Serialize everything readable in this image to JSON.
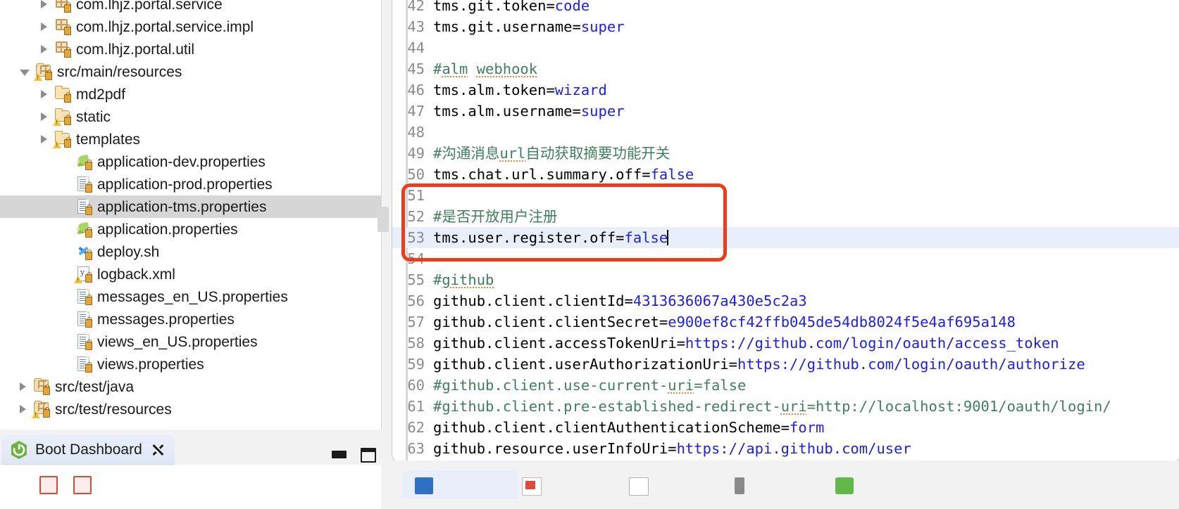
{
  "explorer": {
    "name": "project-explorer",
    "items": [
      {
        "label": "com.lhjz.portal.service",
        "indent": 1,
        "arrow": "right",
        "icon": "package-icon",
        "selected": false
      },
      {
        "label": "com.lhjz.portal.service.impl",
        "indent": 1,
        "arrow": "right",
        "icon": "package-icon",
        "selected": false
      },
      {
        "label": "com.lhjz.portal.util",
        "indent": 1,
        "arrow": "right",
        "icon": "package-icon",
        "selected": false
      },
      {
        "label": "src/main/resources",
        "indent": 0,
        "arrow": "down",
        "icon": "source-folder-warning-icon",
        "selected": false
      },
      {
        "label": "md2pdf",
        "indent": 1,
        "arrow": "right",
        "icon": "folder-icon",
        "selected": false
      },
      {
        "label": "static",
        "indent": 1,
        "arrow": "right",
        "icon": "folder-warning-icon",
        "selected": false
      },
      {
        "label": "templates",
        "indent": 1,
        "arrow": "right",
        "icon": "folder-warning-icon",
        "selected": false
      },
      {
        "label": "application-dev.properties",
        "indent": 2,
        "arrow": "none",
        "icon": "leaf-properties-icon",
        "selected": false
      },
      {
        "label": "application-prod.properties",
        "indent": 2,
        "arrow": "none",
        "icon": "properties-file-icon",
        "selected": false
      },
      {
        "label": "application-tms.properties",
        "indent": 2,
        "arrow": "none",
        "icon": "properties-file-icon",
        "selected": true
      },
      {
        "label": "application.properties",
        "indent": 2,
        "arrow": "none",
        "icon": "leaf-properties-icon",
        "selected": false
      },
      {
        "label": "deploy.sh",
        "indent": 2,
        "arrow": "none",
        "icon": "shell-script-icon",
        "selected": false
      },
      {
        "label": "logback.xml",
        "indent": 2,
        "arrow": "none",
        "icon": "xml-file-warning-icon",
        "selected": false
      },
      {
        "label": "messages_en_US.properties",
        "indent": 2,
        "arrow": "none",
        "icon": "properties-file-icon",
        "selected": false
      },
      {
        "label": "messages.properties",
        "indent": 2,
        "arrow": "none",
        "icon": "properties-file-icon",
        "selected": false
      },
      {
        "label": "views_en_US.properties",
        "indent": 2,
        "arrow": "none",
        "icon": "properties-file-icon",
        "selected": false
      },
      {
        "label": "views.properties",
        "indent": 2,
        "arrow": "none",
        "icon": "properties-file-icon",
        "selected": false
      },
      {
        "label": "src/test/java",
        "indent": 0,
        "arrow": "right",
        "icon": "source-folder-icon",
        "selected": false
      },
      {
        "label": "src/test/resources",
        "indent": 0,
        "arrow": "right",
        "icon": "source-folder-warning-icon",
        "selected": false
      }
    ]
  },
  "bottom_view": {
    "tab_label": "Boot Dashboard",
    "logo_icon": "spring-boot-icon",
    "pin_icon": "pin-view-icon",
    "minimize_icon": "minimize-icon",
    "maximize_icon": "maximize-icon"
  },
  "editor": {
    "name": "application-tms.properties",
    "current_line": 53,
    "cursor_after": "tms.user.register.off=false",
    "annotation": {
      "color": "#ec3c1c",
      "from_line": 51,
      "to_line": 53
    },
    "colors": {
      "text": "#000000",
      "value": "#2020e0",
      "comment": "#3f7f5f",
      "line_number": "#8b8b8b",
      "current_line_bg": "#e9effa",
      "spellcheck_underline": "#e8833a"
    },
    "lines": [
      {
        "n": 42,
        "parts": [
          {
            "t": "tms.git.token=",
            "c": "t"
          },
          {
            "t": "code",
            "c": "v"
          }
        ]
      },
      {
        "n": 43,
        "parts": [
          {
            "t": "tms.git.username=",
            "c": "t"
          },
          {
            "t": "super",
            "c": "v"
          }
        ]
      },
      {
        "n": 44,
        "parts": []
      },
      {
        "n": 45,
        "parts": [
          {
            "t": "#",
            "c": "cm"
          },
          {
            "t": "alm",
            "c": "cm sq"
          },
          {
            "t": " ",
            "c": "cm"
          },
          {
            "t": "webhook",
            "c": "cm sq"
          }
        ]
      },
      {
        "n": 46,
        "parts": [
          {
            "t": "tms.alm.token=",
            "c": "t"
          },
          {
            "t": "wizard",
            "c": "v"
          }
        ]
      },
      {
        "n": 47,
        "parts": [
          {
            "t": "tms.alm.username=",
            "c": "t"
          },
          {
            "t": "super",
            "c": "v"
          }
        ]
      },
      {
        "n": 48,
        "parts": []
      },
      {
        "n": 49,
        "parts": [
          {
            "t": "#沟通消息",
            "c": "cm"
          },
          {
            "t": "url",
            "c": "cm sq"
          },
          {
            "t": "自动获取摘要功能开关",
            "c": "cm"
          }
        ]
      },
      {
        "n": 50,
        "parts": [
          {
            "t": "tms.chat.url.summary.off=",
            "c": "t"
          },
          {
            "t": "false",
            "c": "v"
          }
        ]
      },
      {
        "n": 51,
        "parts": []
      },
      {
        "n": 52,
        "parts": [
          {
            "t": "#是否开放用户注册",
            "c": "cm"
          }
        ]
      },
      {
        "n": 53,
        "parts": [
          {
            "t": "tms.user.register.off=",
            "c": "t"
          },
          {
            "t": "false",
            "c": "v"
          }
        ],
        "current": true,
        "caret": true
      },
      {
        "n": 54,
        "parts": []
      },
      {
        "n": 55,
        "parts": [
          {
            "t": "#",
            "c": "cm"
          },
          {
            "t": "github",
            "c": "cm sq"
          }
        ]
      },
      {
        "n": 56,
        "parts": [
          {
            "t": "github.client.clientId=",
            "c": "t"
          },
          {
            "t": "4313636067a430e5c2a3",
            "c": "v"
          }
        ]
      },
      {
        "n": 57,
        "parts": [
          {
            "t": "github.client.clientSecret=",
            "c": "t"
          },
          {
            "t": "e900ef8cf42ffb045de54db8024f5e4af695a148",
            "c": "v"
          }
        ]
      },
      {
        "n": 58,
        "parts": [
          {
            "t": "github.client.accessTokenUri=",
            "c": "t"
          },
          {
            "t": "https://github.com/login/oauth/access_token",
            "c": "v"
          }
        ]
      },
      {
        "n": 59,
        "parts": [
          {
            "t": "github.client.userAuthorizationUri=",
            "c": "t"
          },
          {
            "t": "https://github.com/login/oauth/authorize",
            "c": "v"
          }
        ]
      },
      {
        "n": 60,
        "parts": [
          {
            "t": "#github.client.use-current-",
            "c": "cm"
          },
          {
            "t": "uri",
            "c": "cm sq"
          },
          {
            "t": "=false",
            "c": "cm"
          }
        ]
      },
      {
        "n": 61,
        "parts": [
          {
            "t": "#github.client.pre-established-redirect-",
            "c": "cm"
          },
          {
            "t": "uri",
            "c": "cm sq"
          },
          {
            "t": "=http://localhost:9001/oauth/login/",
            "c": "cm"
          }
        ]
      },
      {
        "n": 62,
        "parts": [
          {
            "t": "github.client.clientAuthenticationScheme=",
            "c": "t"
          },
          {
            "t": "form",
            "c": "v"
          }
        ]
      },
      {
        "n": 63,
        "parts": [
          {
            "t": "github.resource.userInfoUri=",
            "c": "t"
          },
          {
            "t": "https://api.github.com/user",
            "c": "v"
          }
        ]
      }
    ]
  }
}
